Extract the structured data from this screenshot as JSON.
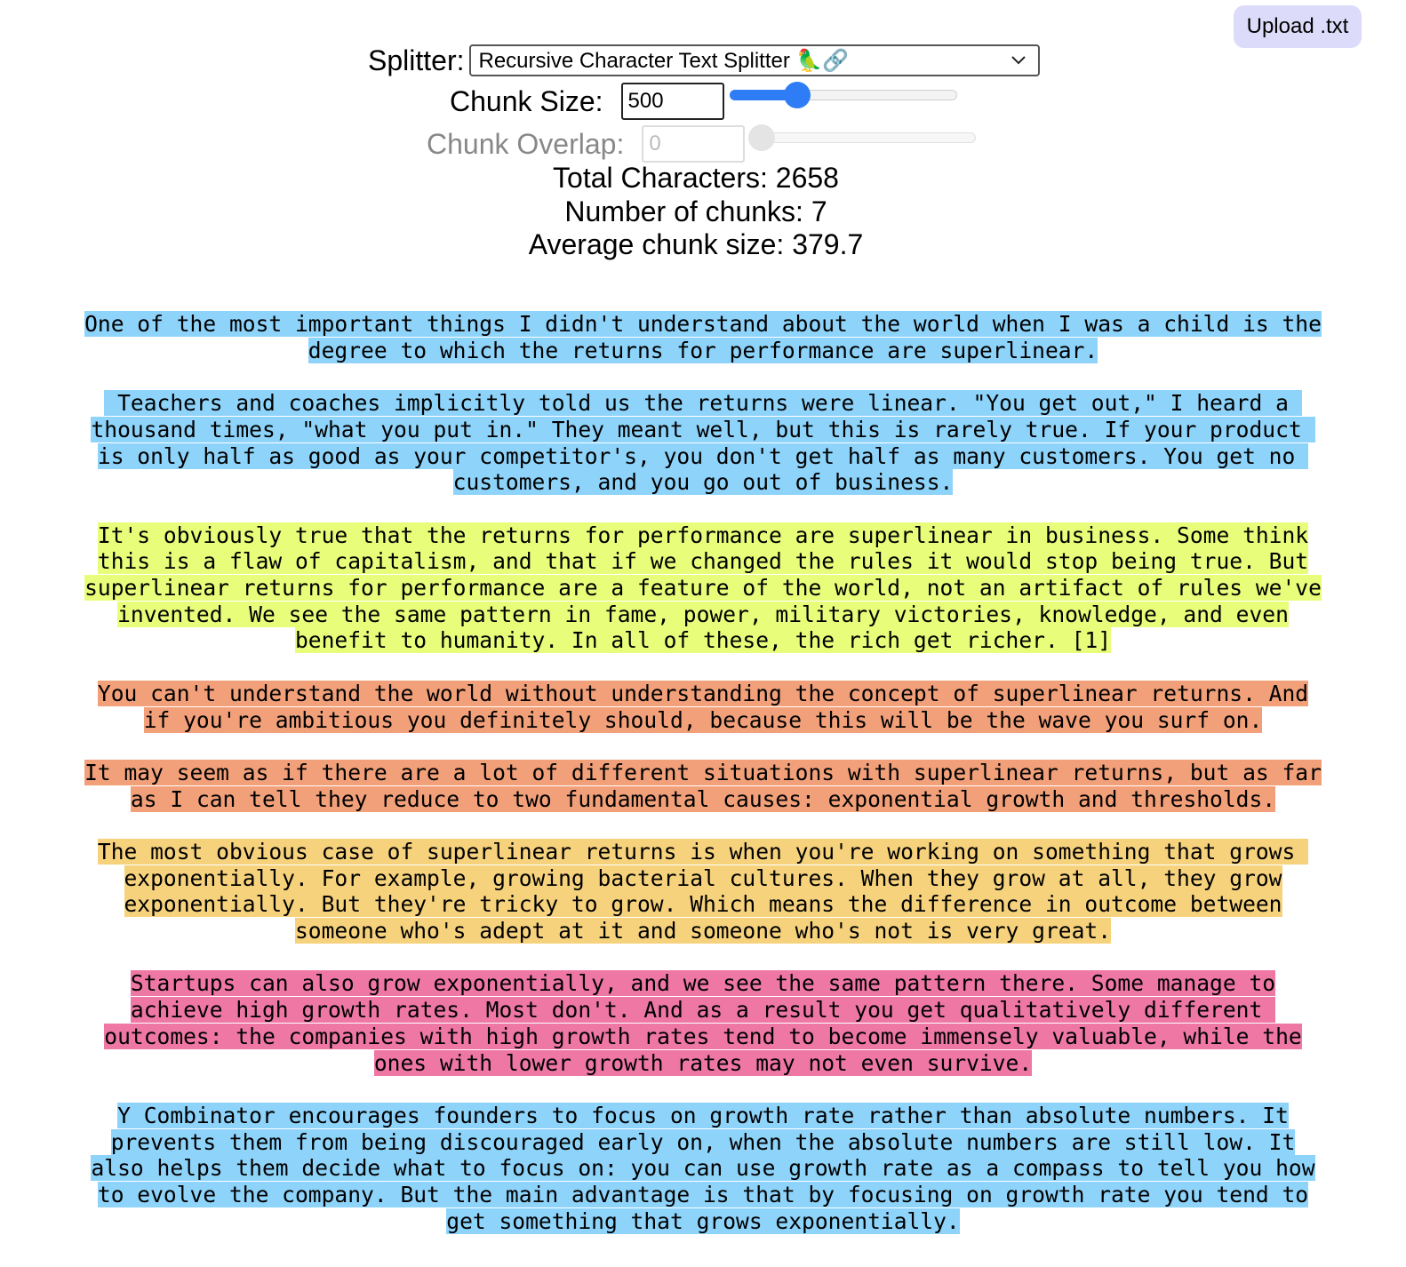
{
  "upload_button": {
    "label": "Upload .txt"
  },
  "splitter": {
    "label": "Splitter:",
    "selected": "Recursive Character Text Splitter 🦜🔗",
    "icon": "chevron-down-icon"
  },
  "chunk_size": {
    "label": "Chunk Size:",
    "value": "500",
    "slider_fraction": 0.27,
    "enabled": true
  },
  "chunk_overlap": {
    "label": "Chunk Overlap:",
    "value": "0",
    "slider_fraction": 0.0,
    "enabled": false
  },
  "stats": {
    "total_characters": "Total Characters: 2658",
    "number_of_chunks": "Number of chunks: 7",
    "average_chunk_size": "Average chunk size: 379.7"
  },
  "colors": {
    "blue": "#8ed3fa",
    "lime": "#e8fd7a",
    "orange": "#f1a07a",
    "gold": "#f6d27d",
    "pink": "#ee77a4",
    "slider_accent": "#2f7df6",
    "upload_bg": "#dcdcfa"
  },
  "paragraphs": [
    {
      "color": "blue",
      "lines": [
        "One of the most important things I didn't understand about the world when I was a child is the",
        "degree to which the returns for performance are superlinear."
      ]
    },
    {
      "color": "blue",
      "lines": [
        " Teachers and coaches implicitly told us the returns were linear. \"You get out,\" I heard a ",
        "thousand times, \"what you put in.\" They meant well, but this is rarely true. If your product ",
        "is only half as good as your competitor's, you don't get half as many customers. You get no ",
        "customers, and you go out of business."
      ]
    },
    {
      "color": "lime",
      "lines": [
        "It's obviously true that the returns for performance are superlinear in business. Some think",
        "this is a flaw of capitalism, and that if we changed the rules it would stop being true. But",
        "superlinear returns for performance are a feature of the world, not an artifact of rules we've",
        "invented. We see the same pattern in fame, power, military victories, knowledge, and even",
        "benefit to humanity. In all of these, the rich get richer. [1]"
      ]
    },
    {
      "color": "orange",
      "lines": [
        "You can't understand the world without understanding the concept of superlinear returns. And",
        "if you're ambitious you definitely should, because this will be the wave you surf on."
      ]
    },
    {
      "color": "orange",
      "lines": [
        "It may seem as if there are a lot of different situations with superlinear returns, but as far",
        "as I can tell they reduce to two fundamental causes: exponential growth and thresholds."
      ]
    },
    {
      "color": "gold",
      "lines": [
        "The most obvious case of superlinear returns is when you're working on something that grows ",
        "exponentially. For example, growing bacterial cultures. When they grow at all, they grow",
        "exponentially. But they're tricky to grow. Which means the difference in outcome between",
        "someone who's adept at it and someone who's not is very great."
      ]
    },
    {
      "color": "pink",
      "lines": [
        "Startups can also grow exponentially, and we see the same pattern there. Some manage to",
        "achieve high growth rates. Most don't. And as a result you get qualitatively different ",
        "outcomes: the companies with high growth rates tend to become immensely valuable, while the",
        "ones with lower growth rates may not even survive."
      ]
    },
    {
      "color": "blue",
      "lines": [
        "Y Combinator encourages founders to focus on growth rate rather than absolute numbers. It",
        "prevents them from being discouraged early on, when the absolute numbers are still low. It",
        "also helps them decide what to focus on: you can use growth rate as a compass to tell you how",
        "to evolve the company. But the main advantage is that by focusing on growth rate you tend to",
        "get something that grows exponentially."
      ]
    }
  ]
}
